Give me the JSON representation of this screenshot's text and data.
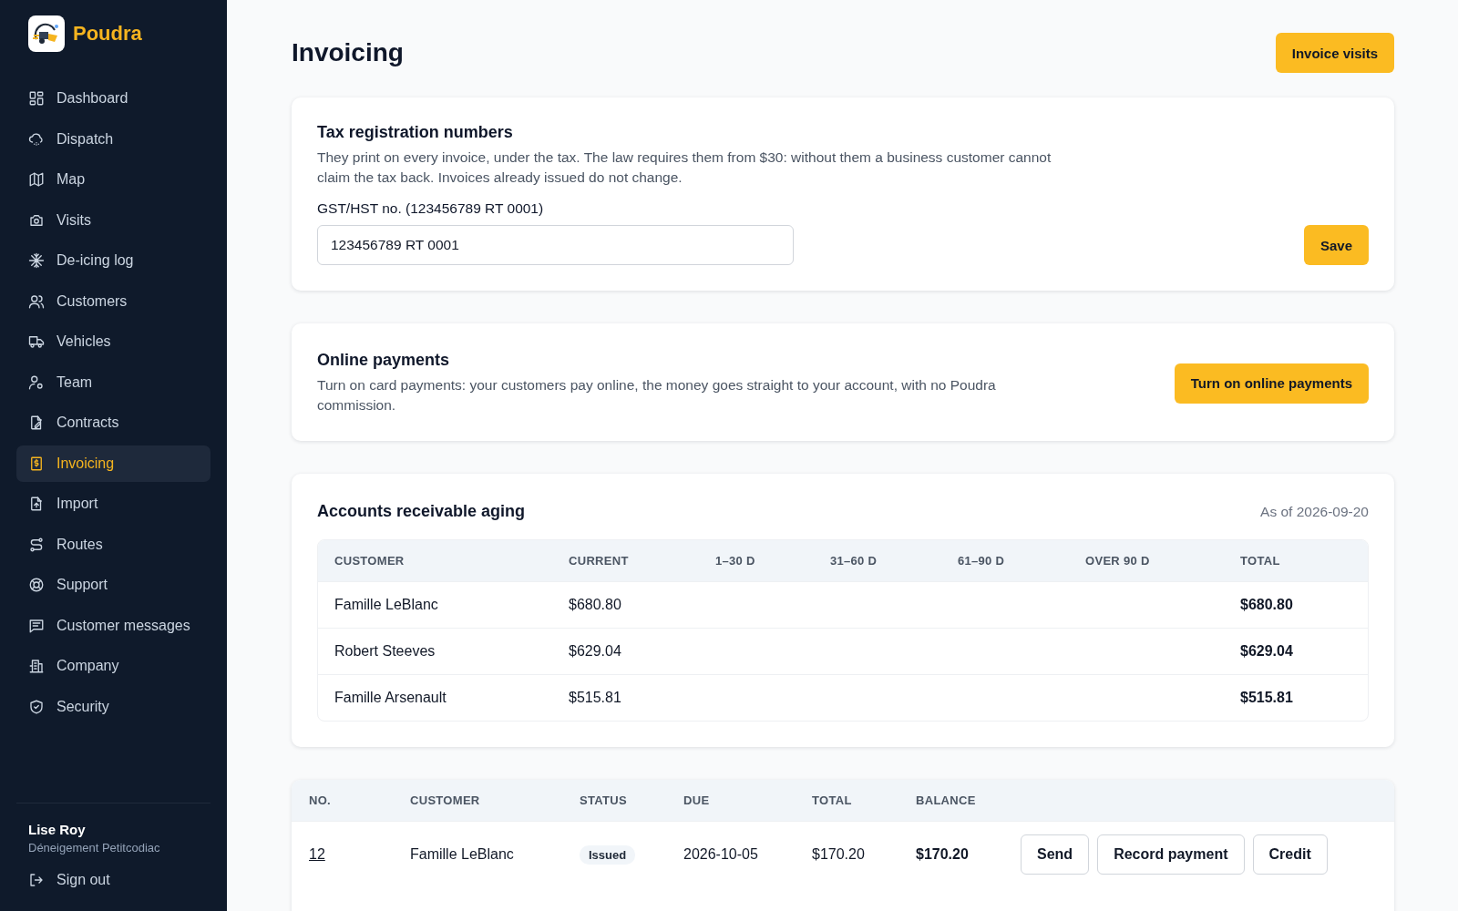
{
  "app": {
    "name": "Poudra"
  },
  "sidebar": {
    "items": [
      {
        "label": "Dashboard",
        "selected": false
      },
      {
        "label": "Dispatch",
        "selected": false
      },
      {
        "label": "Map",
        "selected": false
      },
      {
        "label": "Visits",
        "selected": false
      },
      {
        "label": "De-icing log",
        "selected": false
      },
      {
        "label": "Customers",
        "selected": false
      },
      {
        "label": "Vehicles",
        "selected": false
      },
      {
        "label": "Team",
        "selected": false
      },
      {
        "label": "Contracts",
        "selected": false
      },
      {
        "label": "Invoicing",
        "selected": true
      },
      {
        "label": "Import",
        "selected": false
      },
      {
        "label": "Routes",
        "selected": false
      },
      {
        "label": "Support",
        "selected": false
      },
      {
        "label": "Customer messages",
        "selected": false
      },
      {
        "label": "Company",
        "selected": false
      },
      {
        "label": "Security",
        "selected": false
      }
    ],
    "user": {
      "name": "Lise Roy",
      "company": "Déneigement Petitcodiac"
    },
    "sign_out": "Sign out"
  },
  "page": {
    "title": "Invoicing",
    "action": "Invoice visits"
  },
  "tax_card": {
    "title": "Tax registration numbers",
    "description": "They print on every invoice, under the tax. The law requires them from $30: without them a business customer cannot claim the tax back. Invoices already issued do not change.",
    "field_label": "GST/HST no. (123456789 RT 0001)",
    "field_value": "123456789 RT 0001",
    "button": "Save"
  },
  "payments_card": {
    "title": "Online payments",
    "description": "Turn on card payments: your customers pay online, the money goes straight to your account, with no Poudra commission.",
    "button": "Turn on online payments"
  },
  "aging": {
    "title": "Accounts receivable aging",
    "as_of": "As of 2026-09-20",
    "columns": [
      "CUSTOMER",
      "CURRENT",
      "1–30 D",
      "31–60 D",
      "61–90 D",
      "OVER 90 D",
      "TOTAL"
    ],
    "rows": [
      {
        "customer": "Famille LeBlanc",
        "current": "$680.80",
        "total": "$680.80"
      },
      {
        "customer": "Robert Steeves",
        "current": "$629.04",
        "total": "$629.04"
      },
      {
        "customer": "Famille Arsenault",
        "current": "$515.81",
        "total": "$515.81"
      }
    ]
  },
  "invoices": {
    "columns": [
      "NO.",
      "CUSTOMER",
      "STATUS",
      "DUE",
      "TOTAL",
      "BALANCE"
    ],
    "rows": [
      {
        "number": "12",
        "customer": "Famille LeBlanc",
        "status": "Issued",
        "due": "2026-10-05",
        "total": "$170.20",
        "balance": "$170.20",
        "actions": [
          "Send",
          "Record payment",
          "Credit"
        ]
      }
    ]
  }
}
